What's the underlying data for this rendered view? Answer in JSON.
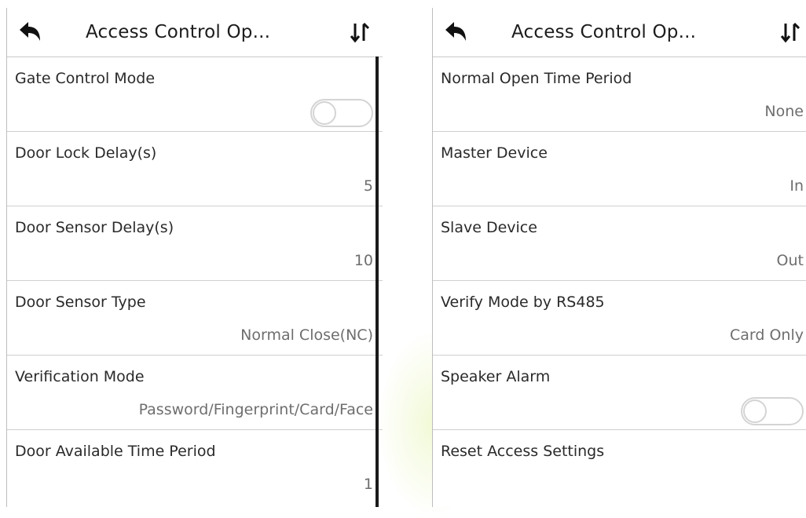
{
  "colors": {
    "background": "#ffffff",
    "text_primary": "#2a2a2a",
    "text_secondary": "#6e6e6e",
    "divider": "#cfcfcf",
    "scrollbar": "#1a1a1a"
  },
  "screens": [
    {
      "header": {
        "title": "Access Control Op...",
        "back_icon": "back-arrow-icon",
        "sort_icon": "sort-up-down-icon"
      },
      "items": [
        {
          "label": "Gate Control Mode",
          "type": "toggle",
          "value_on": false
        },
        {
          "label": "Door Lock Delay(s)",
          "value": "5"
        },
        {
          "label": "Door Sensor Delay(s)",
          "value": "10"
        },
        {
          "label": "Door Sensor Type",
          "value": "Normal Close(NC)"
        },
        {
          "label": "Verification Mode",
          "value": "Password/Fingerprint/Card/Face"
        },
        {
          "label": "Door Available Time Period",
          "value": "1"
        }
      ]
    },
    {
      "header": {
        "title": "Access Control Op...",
        "back_icon": "back-arrow-icon",
        "sort_icon": "sort-up-down-icon"
      },
      "items": [
        {
          "label": "Normal Open Time Period",
          "value": "None"
        },
        {
          "label": "Master Device",
          "value": "In"
        },
        {
          "label": "Slave Device",
          "value": "Out"
        },
        {
          "label": "Verify Mode by RS485",
          "value": "Card Only"
        },
        {
          "label": "Speaker Alarm",
          "type": "toggle",
          "value_on": false
        },
        {
          "label": "Reset Access Settings"
        }
      ]
    }
  ]
}
